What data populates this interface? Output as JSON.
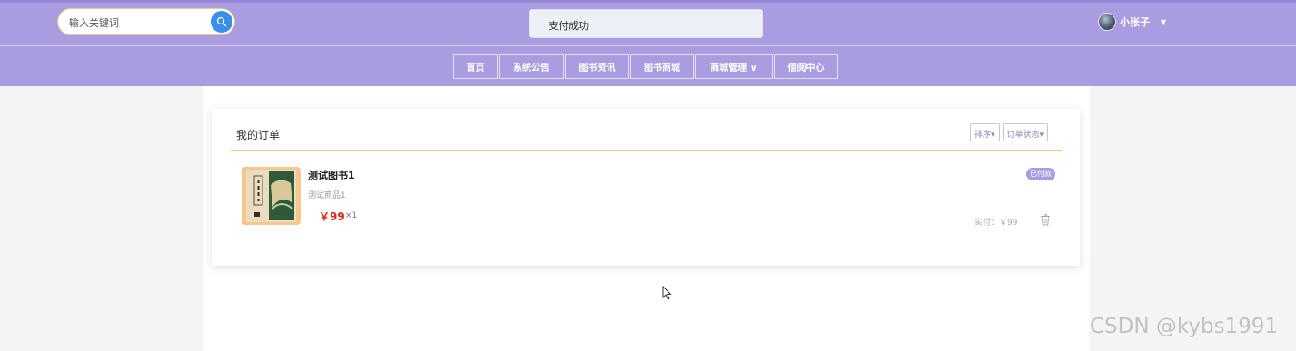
{
  "search": {
    "placeholder": "输入关键词"
  },
  "toast": {
    "message": "支付成功"
  },
  "user": {
    "name": "小张子"
  },
  "nav": {
    "items": [
      {
        "label": "首页"
      },
      {
        "label": "系统公告"
      },
      {
        "label": "图书资讯"
      },
      {
        "label": "图书商城"
      },
      {
        "label": "商城管理 ∨"
      },
      {
        "label": "借阅中心"
      }
    ]
  },
  "orders_section": {
    "title": "我的订单",
    "filters": [
      "排序▾",
      "订单状态▾"
    ],
    "order": {
      "product_name": "测试图书1",
      "product_desc": "测试商品1",
      "price": "￥99",
      "quantity": "×1",
      "status_badge": "已付款",
      "paid_text": "实付：￥99"
    }
  },
  "watermark": "CSDN @kybs1991",
  "colors": {
    "header_bg": "#a99ce0",
    "accent": "#f0c880",
    "price_red": "#e0281a",
    "search_btn": "#3a8fe8"
  }
}
